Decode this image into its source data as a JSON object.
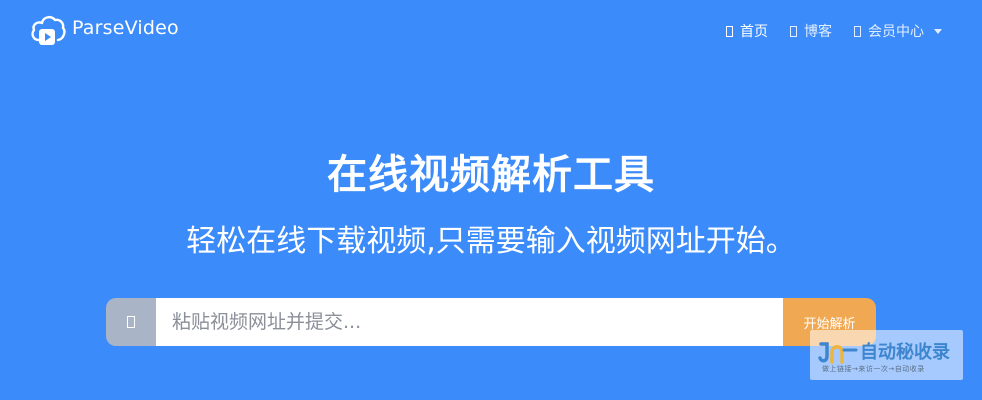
{
  "brand": {
    "name": "ParseVideo"
  },
  "nav": {
    "items": [
      {
        "label": "首页",
        "active": true
      },
      {
        "label": "博客",
        "active": false
      },
      {
        "label": "会员中心",
        "active": false
      }
    ]
  },
  "hero": {
    "title": "在线视频解析工具",
    "subtitle": "轻松在线下载视频,只需要输入视频网址开始。"
  },
  "search": {
    "placeholder": "粘贴视频网址并提交...",
    "value": "",
    "button_label": "开始解析"
  },
  "watermark": {
    "title": "自动秘收录",
    "subtitle": "做上链接→来访一次→自动收录"
  },
  "colors": {
    "background": "#3b8bfb",
    "button": "#f1a852",
    "addon": "#a9b4c6"
  },
  "icons": {
    "brand": "cloud-play-icon",
    "nav": "missing-glyph-icon",
    "search_addon": "missing-glyph-icon",
    "dropdown": "caret-down-icon"
  }
}
